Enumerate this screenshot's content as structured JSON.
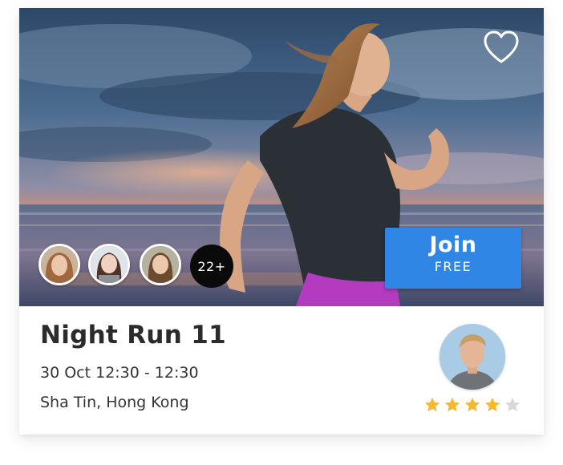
{
  "event": {
    "title": "Night Run 11",
    "datetime": "30 Oct 12:30 - 12:30",
    "location": "Sha Tin, Hong Kong"
  },
  "join_button": {
    "label": "Join",
    "sublabel": "FREE"
  },
  "attendees": {
    "avatars": [
      "avatar-1",
      "avatar-2",
      "avatar-3"
    ],
    "more_count_label": "22+"
  },
  "favorite": {
    "icon": "heart-outline-icon",
    "active": false
  },
  "host": {
    "icon": "host-avatar"
  },
  "rating": {
    "value": 4,
    "max": 5
  },
  "colors": {
    "accent": "#2f86e5",
    "star_filled": "#f5b82e",
    "star_empty": "#d8d8d8",
    "title_text": "#2b2b2b",
    "badge_bg": "#0a0a0a"
  }
}
